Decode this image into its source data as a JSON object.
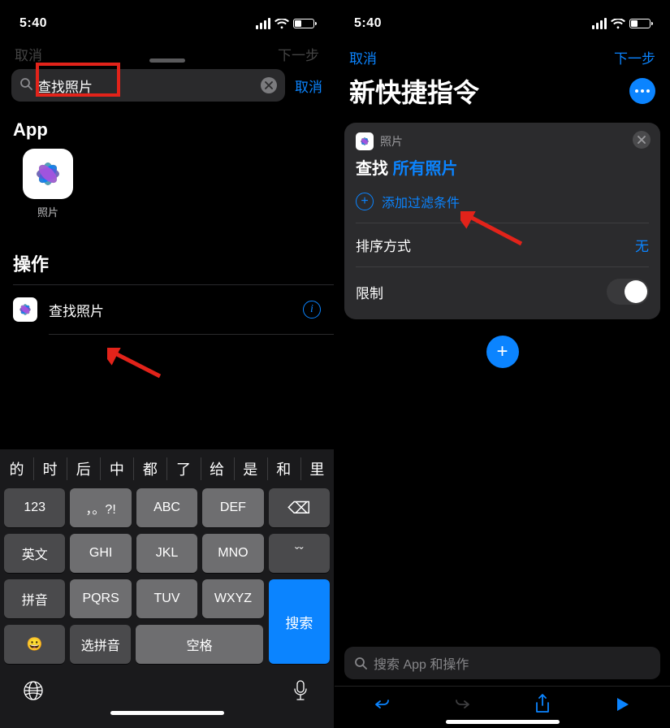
{
  "status": {
    "time": "5:40"
  },
  "colors": {
    "blue": "#0b84ff",
    "red": "#e2231a"
  },
  "left": {
    "dim_cancel": "取消",
    "dim_next": "下一步",
    "search": {
      "value": "查找照片"
    },
    "cancel": "取消",
    "section_app": "App",
    "app_tile": {
      "label": "照片",
      "icon": "photos-icon"
    },
    "section_actions": "操作",
    "action": {
      "label": "查找照片",
      "icon": "photos-icon"
    },
    "predictions": [
      "的",
      "时",
      "后",
      "中",
      "都",
      "了",
      "给",
      "是",
      "和",
      "里"
    ],
    "keys": {
      "r1": [
        "123",
        "，。?!",
        "ABC",
        "DEF"
      ],
      "r2": [
        "英文",
        "GHI",
        "JKL",
        "MNO"
      ],
      "r3": [
        "拼音",
        "PQRS",
        "TUV",
        "WXYZ"
      ],
      "r4": [
        "选拼音",
        "空格"
      ],
      "backspace": "⌫",
      "reexpand": "ˇˇ",
      "search": "搜索",
      "emoji": "😀"
    }
  },
  "right": {
    "nav_cancel": "取消",
    "nav_next": "下一步",
    "title": "新快捷指令",
    "card": {
      "app": "照片",
      "find": "查找",
      "all_photos": "所有照片",
      "add_filter": "添加过滤条件",
      "sort_label": "排序方式",
      "sort_value": "无",
      "limit_label": "限制"
    },
    "search_placeholder": "搜索 App 和操作"
  }
}
